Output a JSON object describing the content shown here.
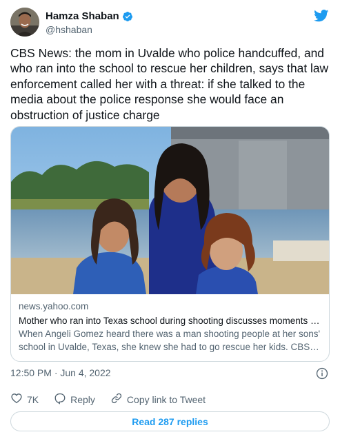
{
  "author": {
    "name": "Hamza Shaban",
    "handle": "@hshaban"
  },
  "tweet": {
    "text": "CBS News: the mom in Uvalde who police handcuffed, and who ran into the school to rescue her children, says that law enforcement called her with a threat: if she talked to the media about the police response she would face an obstruction of justice charge"
  },
  "card": {
    "domain": "news.yahoo.com",
    "title": "Mother who ran into Texas school during shooting discusses moments i…",
    "description": "When Angeli Gomez heard there was a man shooting people at her sons' school in Uvalde, Texas, she knew she had to go rescue her kids. CBS …"
  },
  "meta": {
    "timestamp": "12:50 PM · Jun 4, 2022"
  },
  "actions": {
    "like_count": "7K",
    "reply_label": "Reply",
    "copy_label": "Copy link to Tweet"
  },
  "read_replies_label": "Read 287 replies",
  "colors": {
    "accent": "#1d9bf0",
    "secondary_text": "#536471",
    "border": "#cfd9de"
  },
  "icons": [
    "twitter-bird-icon",
    "verified-badge-icon",
    "info-icon",
    "heart-icon",
    "reply-icon",
    "link-icon"
  ]
}
